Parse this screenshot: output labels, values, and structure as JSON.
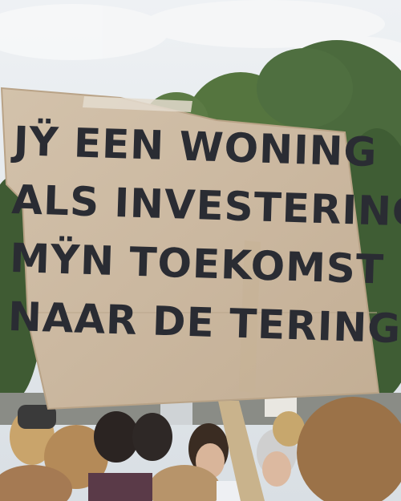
{
  "sign": {
    "lines": [
      "JŸ EEN WONING",
      "ALS INVESTERING",
      "MŸN TOEKOMST",
      "NAAR DE TERING"
    ]
  },
  "colors": {
    "sky": "#dfe5ea",
    "trees": "#4a6b3c",
    "cardboard": "#cdbba4",
    "ink": "#2a2c33"
  }
}
